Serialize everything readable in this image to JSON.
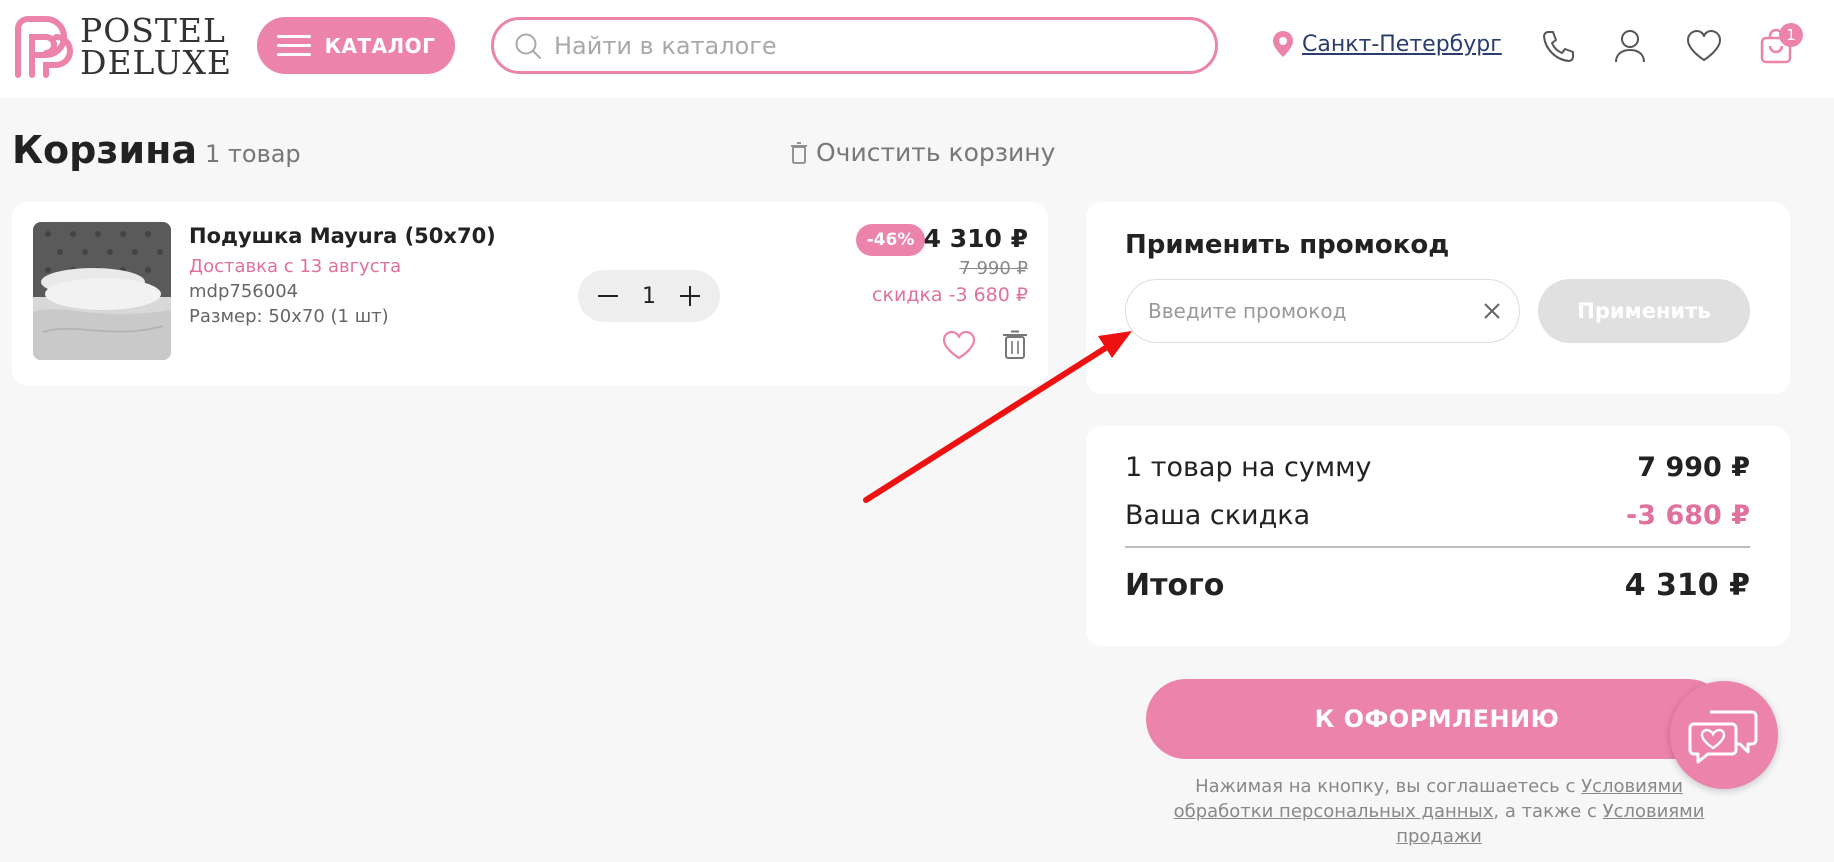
{
  "header": {
    "logo_line1": "POSTEL",
    "logo_line2": "DELUXE",
    "catalog_label": "КАТАЛОГ",
    "search_placeholder": "Найти в каталоге",
    "city": "Санкт-Петербург",
    "cart_count": "1"
  },
  "page": {
    "title": "Корзина",
    "count": "1 товар",
    "clear_label": "Очистить корзину"
  },
  "item": {
    "name": "Подушка Mayura (50x70)",
    "delivery": "Доставка с 13 августа",
    "sku": "mdp756004",
    "size": "Размер: 50x70 (1 шт)",
    "quantity": "1",
    "badge": "-46%",
    "price": "4 310 ₽",
    "old_price": "7 990 ₽",
    "discount": "скидка -3 680 ₽"
  },
  "promo": {
    "title": "Применить промокод",
    "placeholder": "Введите промокод",
    "apply_label": "Применить"
  },
  "summary": {
    "items_label": "1 товар на сумму",
    "items_value": "7 990 ₽",
    "discount_label": "Ваша скидка",
    "discount_value": "-3 680 ₽",
    "total_label": "Итого",
    "total_value": "4 310 ₽"
  },
  "checkout": {
    "button_label": "К ОФОРМЛЕНИЮ",
    "agree_prefix": "Нажимая на кнопку, вы соглашаетесь с ",
    "agree_link1": "Условиями обработки персональных данных",
    "agree_middle": ", а также с ",
    "agree_link2": "Условиями продажи"
  },
  "colors": {
    "accent": "#ec83ab",
    "accent_text": "#e0709d",
    "annotation_arrow": "#ee1111"
  }
}
